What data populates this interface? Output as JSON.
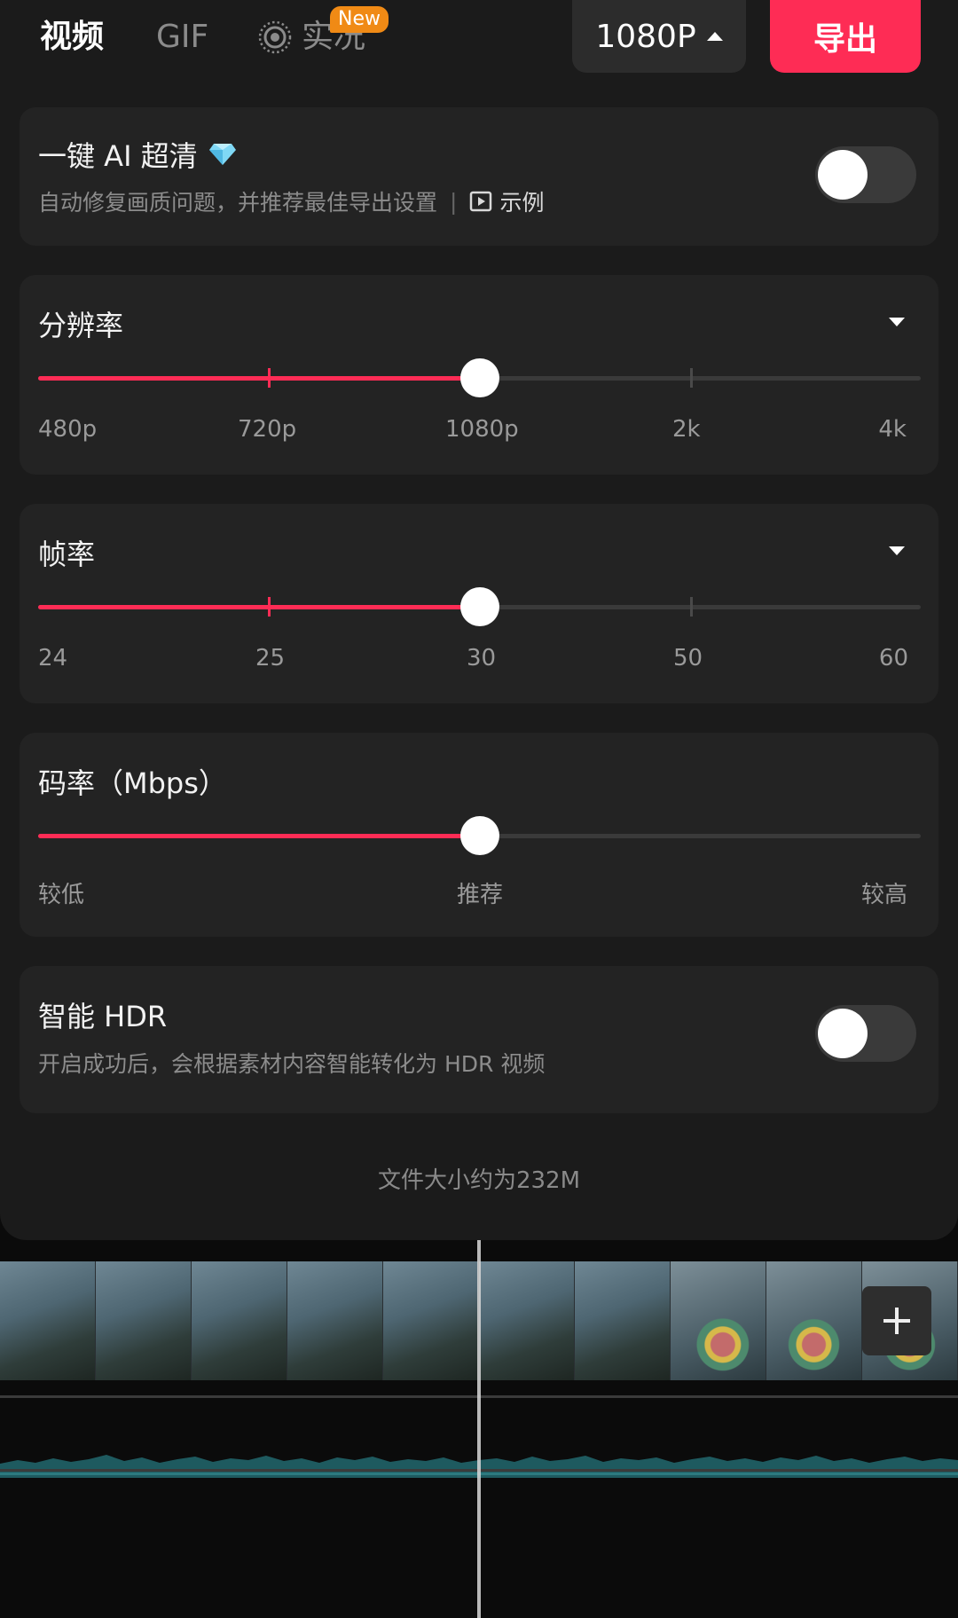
{
  "header": {
    "tabs": [
      {
        "label": "视频",
        "active": true
      },
      {
        "label": "GIF",
        "active": false
      },
      {
        "label": "实况",
        "active": false,
        "icon": "live-photo-icon",
        "badge": "New"
      }
    ],
    "resolution_button": "1080P",
    "export_button": "导出"
  },
  "ai_enhance": {
    "title": "一键 AI 超清",
    "icon": "diamond-icon",
    "description": "自动修复画质问题，并推荐最佳导出设置",
    "separator": "|",
    "example_link": "示例",
    "enabled": false
  },
  "resolution": {
    "title": "分辨率",
    "options": [
      "480p",
      "720p",
      "1080p",
      "2k",
      "4k"
    ],
    "selected": "1080p",
    "selected_fraction": 0.5
  },
  "frame_rate": {
    "title": "帧率",
    "options": [
      "24",
      "25",
      "30",
      "50",
      "60"
    ],
    "selected": "30",
    "selected_fraction": 0.5
  },
  "bitrate": {
    "title": "码率（Mbps）",
    "options": [
      "较低",
      "推荐",
      "较高"
    ],
    "selected": "推荐",
    "selected_fraction": 0.5
  },
  "smart_hdr": {
    "title": "智能 HDR",
    "description": "开启成功后，会根据素材内容智能转化为 HDR 视频",
    "enabled": false
  },
  "file_size": "文件大小约为232M",
  "colors": {
    "accent": "#fe2c55",
    "badge": "#f08a15",
    "card_bg": "#232323",
    "sheet_bg": "#1b1b1b"
  }
}
